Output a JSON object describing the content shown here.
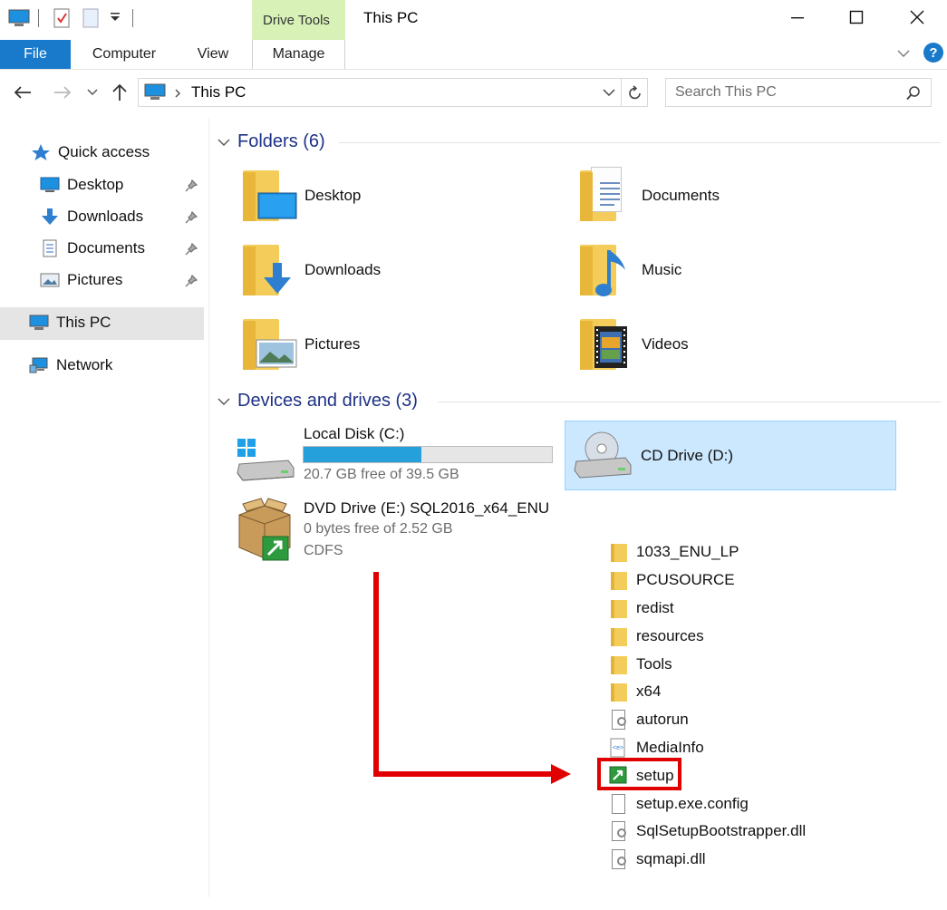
{
  "title_bar": {
    "context_tab": "Drive Tools",
    "window_title": "This PC",
    "minimize": "—",
    "maximize": "☐",
    "close": "✕"
  },
  "ribbon": {
    "file": "File",
    "tabs": [
      "Computer",
      "View",
      "Manage"
    ],
    "help": "?"
  },
  "address_bar": {
    "path": "This PC",
    "search_placeholder": "Search This PC"
  },
  "nav_pane": {
    "quick_access": "Quick access",
    "pinned": [
      "Desktop",
      "Downloads",
      "Documents",
      "Pictures"
    ],
    "this_pc": "This PC",
    "network": "Network"
  },
  "folders_section": {
    "header": "Folders (6)",
    "items": [
      "Desktop",
      "Documents",
      "Downloads",
      "Music",
      "Pictures",
      "Videos"
    ]
  },
  "drives_section": {
    "header": "Devices and drives (3)",
    "local_disk": {
      "name": "Local Disk (C:)",
      "free": "20.7 GB free of 39.5 GB",
      "used_fraction": 0.476
    },
    "cd_drive": {
      "name": "CD Drive (D:)"
    },
    "dvd_drive": {
      "name": "DVD Drive (E:) SQL2016_x64_ENU",
      "free": "0 bytes free of 2.52 GB",
      "fs": "CDFS"
    }
  },
  "file_list": [
    {
      "name": "1033_ENU_LP",
      "type": "folder"
    },
    {
      "name": "PCUSOURCE",
      "type": "folder"
    },
    {
      "name": "redist",
      "type": "folder"
    },
    {
      "name": "resources",
      "type": "folder"
    },
    {
      "name": "Tools",
      "type": "folder"
    },
    {
      "name": "x64",
      "type": "folder"
    },
    {
      "name": "autorun",
      "type": "config"
    },
    {
      "name": "MediaInfo",
      "type": "xml"
    },
    {
      "name": "setup",
      "type": "exe"
    },
    {
      "name": "setup.exe.config",
      "type": "file"
    },
    {
      "name": "SqlSetupBootstrapper.dll",
      "type": "dll"
    },
    {
      "name": "sqmapi.dll",
      "type": "dll"
    }
  ],
  "colors": {
    "accent": "#1979ca",
    "context_tab": "#d7f1b7",
    "section_header": "#1e3287",
    "selection": "#cce8ff",
    "annotation": "#e00000"
  }
}
